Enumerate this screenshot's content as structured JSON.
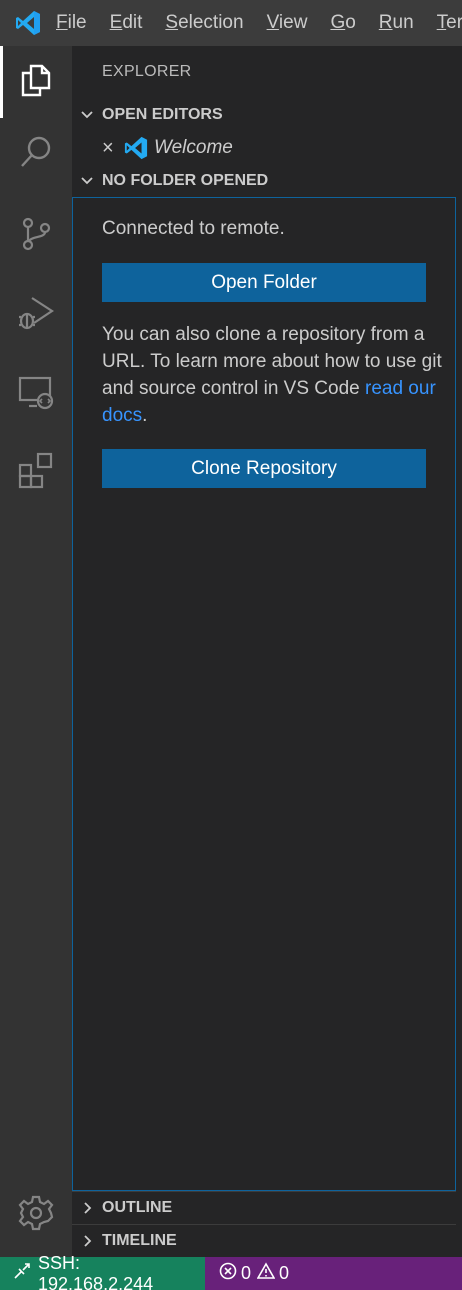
{
  "menu": {
    "items": [
      {
        "mnemonic": "F",
        "rest": "ile"
      },
      {
        "mnemonic": "E",
        "rest": "dit"
      },
      {
        "mnemonic": "S",
        "rest": "election"
      },
      {
        "mnemonic": "V",
        "rest": "iew"
      },
      {
        "mnemonic": "G",
        "rest": "o"
      },
      {
        "mnemonic": "R",
        "rest": "un"
      },
      {
        "mnemonic": "T",
        "rest": "erminal"
      }
    ]
  },
  "activity_bar": {
    "items": [
      "files-icon",
      "search-icon",
      "source-control-icon",
      "run-debug-icon",
      "remote-explorer-icon",
      "extensions-icon",
      "manage-gear-icon"
    ],
    "active": "files-icon"
  },
  "sidebar": {
    "title": "EXPLORER",
    "open_editors": {
      "header": "OPEN EDITORS",
      "items": [
        {
          "label": "Welcome"
        }
      ]
    },
    "no_folder": {
      "header": "NO FOLDER OPENED",
      "message": "Connected to remote.",
      "open_folder_button": "Open Folder",
      "clone_text": "You can also clone a repository from a URL. To learn more about how to use git and source control in VS Code",
      "docs_link": "read our docs",
      "docs_suffix": ".",
      "clone_button": "Clone Repository"
    },
    "outline": "OUTLINE",
    "timeline": "TIMELINE"
  },
  "status_bar": {
    "remote_label": "SSH: 192.168.2.244",
    "errors": "0",
    "warnings": "0",
    "remote_color": "#16825d",
    "bar_color": "#68217a"
  },
  "colors": {
    "accent_button": "#0e639c",
    "link": "#3794ff"
  }
}
